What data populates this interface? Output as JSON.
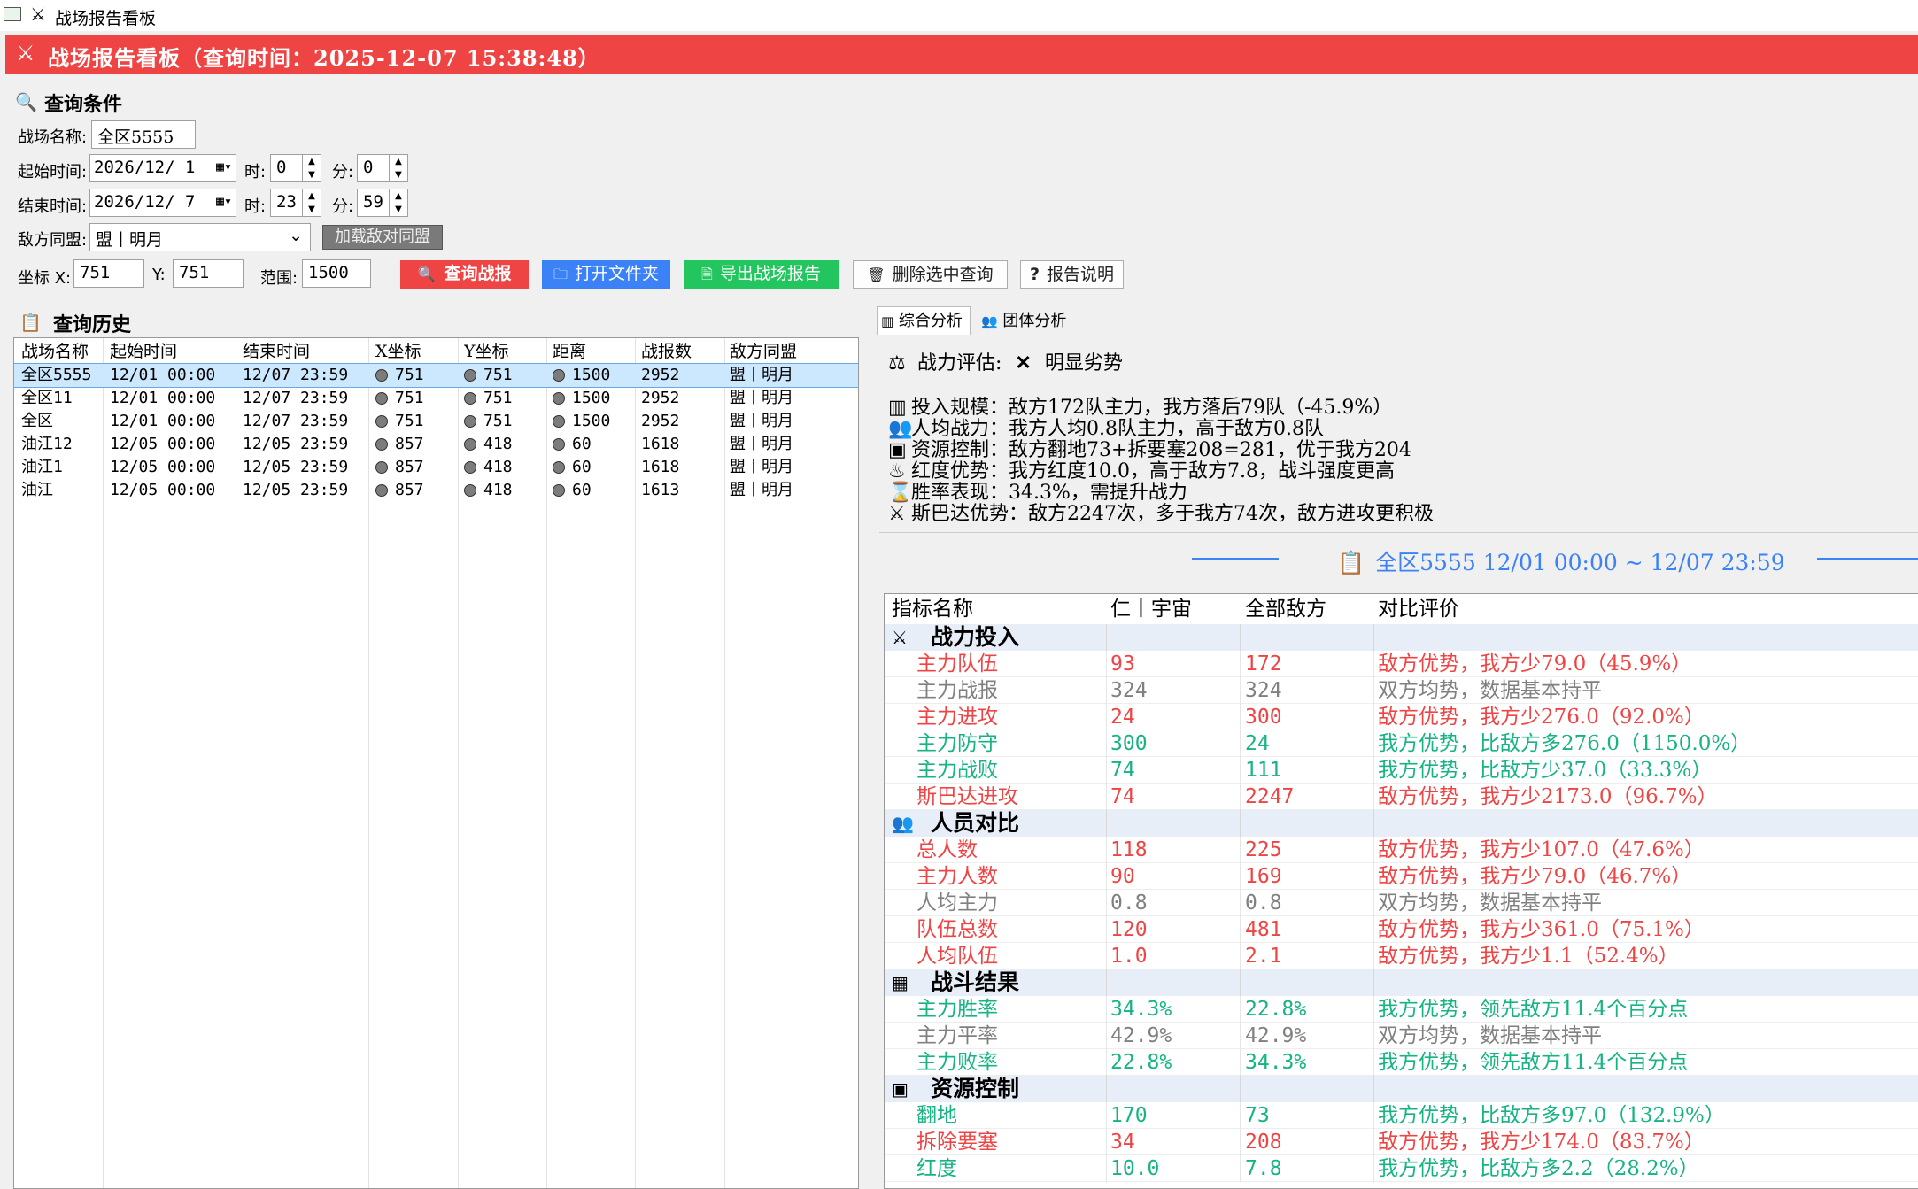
{
  "window": {
    "title": "战场报告看板"
  },
  "banner": {
    "text": "战场报告看板（查询时间：2025-12-07 15:38:48）"
  },
  "query": {
    "heading": "查询条件",
    "battlefield_label": "战场名称:",
    "battlefield_value": "全区5555",
    "start_label": "起始时间:",
    "start_date": "2026/12/  1",
    "start_hour_label": "时:",
    "start_hour": "0",
    "start_min_label": "分:",
    "start_min": "0",
    "end_label": "结束时间:",
    "end_date": "2026/12/  7",
    "end_hour_label": "时:",
    "end_hour": "23",
    "end_min_label": "分:",
    "end_min": "59",
    "enemy_label": "敌方同盟:",
    "enemy_value": "盟丨明月",
    "load_enemy_button": "加载敌对同盟",
    "x_label": "坐标 X:",
    "x_value": "751",
    "y_label": "Y:",
    "y_value": "751",
    "range_label": "范围:",
    "range_value": "1500"
  },
  "buttons": {
    "query": "查询战报",
    "open_folder": "打开文件夹",
    "export": "导出战场报告",
    "delete": "删除选中查询",
    "help": "报告说明"
  },
  "history": {
    "heading": "查询历史",
    "columns": [
      "战场名称",
      "起始时间",
      "结束时间",
      "X坐标",
      "Y坐标",
      "距离",
      "战报数",
      "敌方同盟"
    ],
    "rows": [
      [
        "全区5555",
        "12/01 00:00",
        "12/07 23:59",
        "751",
        "751",
        "1500",
        "2952",
        "盟丨明月"
      ],
      [
        "全区11",
        "12/01 00:00",
        "12/07 23:59",
        "751",
        "751",
        "1500",
        "2952",
        "盟丨明月"
      ],
      [
        "全区",
        "12/01 00:00",
        "12/07 23:59",
        "751",
        "751",
        "1500",
        "2952",
        "盟丨明月"
      ],
      [
        "油江12",
        "12/05 00:00",
        "12/05 23:59",
        "857",
        "418",
        "60",
        "1618",
        "盟丨明月"
      ],
      [
        "油江1",
        "12/05 00:00",
        "12/05 23:59",
        "857",
        "418",
        "60",
        "1618",
        "盟丨明月"
      ],
      [
        "油江",
        "12/05 00:00",
        "12/05 23:59",
        "857",
        "418",
        "60",
        "1613",
        "盟丨明月"
      ]
    ]
  },
  "tabs": {
    "overall": "综合分析",
    "team": "团体分析"
  },
  "summary": {
    "eval_label": "战力评估:",
    "eval_value": "明显劣势",
    "lines": [
      "投入规模：敌方172队主力，我方落后79队（-45.9%）",
      "人均战力：我方人均0.8队主力，高于敌方0.8队",
      "资源控制：敌方翻地73+拆要塞208=281，优于我方204",
      "红度优势：我方红度10.0，高于敌方7.8，战斗强度更高",
      "胜率表现：34.3%，需提升战力",
      "斯巴达优势：敌方2247次，多于我方74次，敌方进攻更积极"
    ],
    "range_title": "全区5555 12/01 00:00 ~ 12/07 23:59"
  },
  "metrics": {
    "columns": [
      "指标名称",
      "仁丨宇宙",
      "全部敌方",
      "对比评价"
    ],
    "colors": {
      "red": "#ef4444",
      "green": "#16b383",
      "gray": "#808080"
    },
    "rows": [
      {
        "group": "战力投入"
      },
      {
        "name": "主力队伍",
        "us": "93",
        "them": "172",
        "eval": "敌方优势，我方少79.0（45.9%）",
        "tone": "red"
      },
      {
        "name": "主力战报",
        "us": "324",
        "them": "324",
        "eval": "双方均势，数据基本持平",
        "tone": "gray"
      },
      {
        "name": "主力进攻",
        "us": "24",
        "them": "300",
        "eval": "敌方优势，我方少276.0（92.0%）",
        "tone": "red"
      },
      {
        "name": "主力防守",
        "us": "300",
        "them": "24",
        "eval": "我方优势，比敌方多276.0（1150.0%）",
        "tone": "green"
      },
      {
        "name": "主力战败",
        "us": "74",
        "them": "111",
        "eval": "我方优势，比敌方少37.0（33.3%）",
        "tone": "green"
      },
      {
        "name": "斯巴达进攻",
        "us": "74",
        "them": "2247",
        "eval": "敌方优势，我方少2173.0（96.7%）",
        "tone": "red"
      },
      {
        "group": "人员对比"
      },
      {
        "name": "总人数",
        "us": "118",
        "them": "225",
        "eval": "敌方优势，我方少107.0（47.6%）",
        "tone": "red"
      },
      {
        "name": "主力人数",
        "us": "90",
        "them": "169",
        "eval": "敌方优势，我方少79.0（46.7%）",
        "tone": "red"
      },
      {
        "name": "人均主力",
        "us": "0.8",
        "them": "0.8",
        "eval": "双方均势，数据基本持平",
        "tone": "gray"
      },
      {
        "name": "队伍总数",
        "us": "120",
        "them": "481",
        "eval": "敌方优势，我方少361.0（75.1%）",
        "tone": "red"
      },
      {
        "name": "人均队伍",
        "us": "1.0",
        "them": "2.1",
        "eval": "敌方优势，我方少1.1（52.4%）",
        "tone": "red"
      },
      {
        "group": "战斗结果"
      },
      {
        "name": "主力胜率",
        "us": "34.3%",
        "them": "22.8%",
        "eval": "我方优势，领先敌方11.4个百分点",
        "tone": "green"
      },
      {
        "name": "主力平率",
        "us": "42.9%",
        "them": "42.9%",
        "eval": "双方均势，数据基本持平",
        "tone": "gray"
      },
      {
        "name": "主力败率",
        "us": "22.8%",
        "them": "34.3%",
        "eval": "我方优势，领先敌方11.4个百分点",
        "tone": "green"
      },
      {
        "group": "资源控制"
      },
      {
        "name": "翻地",
        "us": "170",
        "them": "73",
        "eval": "我方优势，比敌方多97.0（132.9%）",
        "tone": "green"
      },
      {
        "name": "拆除要塞",
        "us": "34",
        "them": "208",
        "eval": "敌方优势，我方少174.0（83.7%）",
        "tone": "red"
      },
      {
        "name": "红度",
        "us": "10.0",
        "them": "7.8",
        "eval": "我方优势，比敌方多2.2（28.2%）",
        "tone": "green"
      }
    ]
  }
}
